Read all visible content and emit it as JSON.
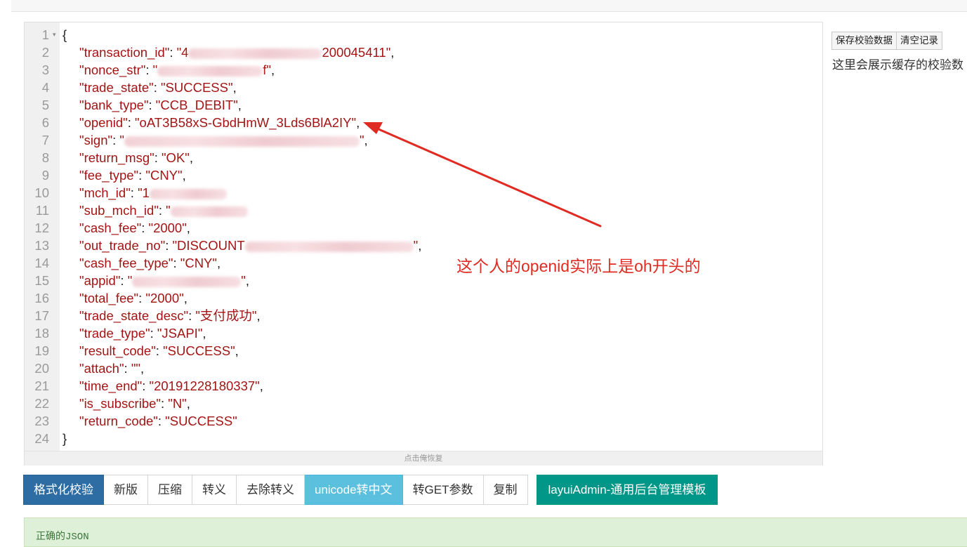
{
  "editor": {
    "lines": [
      {
        "n": "1",
        "fold": "▾",
        "parts": [
          {
            "t": "punc",
            "v": "{"
          }
        ]
      },
      {
        "n": "2",
        "parts": [
          {
            "t": "key",
            "v": "\"transaction_id\""
          },
          {
            "t": "punc",
            "v": ": "
          },
          {
            "t": "str",
            "v": "\"4"
          },
          {
            "t": "blur",
            "w": 190
          },
          {
            "t": "str",
            "v": "200045411\""
          },
          {
            "t": "punc",
            "v": ","
          }
        ]
      },
      {
        "n": "3",
        "parts": [
          {
            "t": "key",
            "v": "\"nonce_str\""
          },
          {
            "t": "punc",
            "v": ": "
          },
          {
            "t": "str",
            "v": "\""
          },
          {
            "t": "blur",
            "w": 150
          },
          {
            "t": "str",
            "v": "f\""
          },
          {
            "t": "punc",
            "v": ","
          }
        ]
      },
      {
        "n": "4",
        "parts": [
          {
            "t": "key",
            "v": "\"trade_state\""
          },
          {
            "t": "punc",
            "v": ": "
          },
          {
            "t": "str",
            "v": "\"SUCCESS\""
          },
          {
            "t": "punc",
            "v": ","
          }
        ]
      },
      {
        "n": "5",
        "parts": [
          {
            "t": "key",
            "v": "\"bank_type\""
          },
          {
            "t": "punc",
            "v": ": "
          },
          {
            "t": "str",
            "v": "\"CCB_DEBIT\""
          },
          {
            "t": "punc",
            "v": ","
          }
        ]
      },
      {
        "n": "6",
        "parts": [
          {
            "t": "key",
            "v": "\"openid\""
          },
          {
            "t": "punc",
            "v": ": "
          },
          {
            "t": "str",
            "v": "\"oAT3B58xS-GbdHmW_3Lds6BlA2IY\""
          },
          {
            "t": "punc",
            "v": ","
          }
        ]
      },
      {
        "n": "7",
        "parts": [
          {
            "t": "key",
            "v": "\"sign\""
          },
          {
            "t": "punc",
            "v": ": "
          },
          {
            "t": "str",
            "v": "\""
          },
          {
            "t": "blur",
            "w": 335
          },
          {
            "t": "str",
            "v": "\""
          },
          {
            "t": "punc",
            "v": ","
          }
        ]
      },
      {
        "n": "8",
        "parts": [
          {
            "t": "key",
            "v": "\"return_msg\""
          },
          {
            "t": "punc",
            "v": ": "
          },
          {
            "t": "str",
            "v": "\"OK\""
          },
          {
            "t": "punc",
            "v": ","
          }
        ]
      },
      {
        "n": "9",
        "parts": [
          {
            "t": "key",
            "v": "\"fee_type\""
          },
          {
            "t": "punc",
            "v": ": "
          },
          {
            "t": "str",
            "v": "\"CNY\""
          },
          {
            "t": "punc",
            "v": ","
          }
        ]
      },
      {
        "n": "10",
        "parts": [
          {
            "t": "key",
            "v": "\"mch_id\""
          },
          {
            "t": "punc",
            "v": ": "
          },
          {
            "t": "str",
            "v": "\"1"
          },
          {
            "t": "blur",
            "w": 110
          }
        ]
      },
      {
        "n": "11",
        "parts": [
          {
            "t": "key",
            "v": "\"sub_mch_id\""
          },
          {
            "t": "punc",
            "v": ": "
          },
          {
            "t": "str",
            "v": "\""
          },
          {
            "t": "blur",
            "w": 110
          }
        ]
      },
      {
        "n": "12",
        "parts": [
          {
            "t": "key",
            "v": "\"cash_fee\""
          },
          {
            "t": "punc",
            "v": ": "
          },
          {
            "t": "str",
            "v": "\"2000\""
          },
          {
            "t": "punc",
            "v": ","
          }
        ]
      },
      {
        "n": "13",
        "parts": [
          {
            "t": "key",
            "v": "\"out_trade_no\""
          },
          {
            "t": "punc",
            "v": ": "
          },
          {
            "t": "str",
            "v": "\"DISCOUNT"
          },
          {
            "t": "blur",
            "w": 240
          },
          {
            "t": "str",
            "v": "\""
          },
          {
            "t": "punc",
            "v": ","
          }
        ]
      },
      {
        "n": "14",
        "parts": [
          {
            "t": "key",
            "v": "\"cash_fee_type\""
          },
          {
            "t": "punc",
            "v": ": "
          },
          {
            "t": "str",
            "v": "\"CNY\""
          },
          {
            "t": "punc",
            "v": ","
          }
        ]
      },
      {
        "n": "15",
        "parts": [
          {
            "t": "key",
            "v": "\"appid\""
          },
          {
            "t": "punc",
            "v": ": "
          },
          {
            "t": "str",
            "v": "\""
          },
          {
            "t": "blur",
            "w": 155
          },
          {
            "t": "str",
            "v": "\""
          },
          {
            "t": "punc",
            "v": ","
          }
        ]
      },
      {
        "n": "16",
        "parts": [
          {
            "t": "key",
            "v": "\"total_fee\""
          },
          {
            "t": "punc",
            "v": ": "
          },
          {
            "t": "str",
            "v": "\"2000\""
          },
          {
            "t": "punc",
            "v": ","
          }
        ]
      },
      {
        "n": "17",
        "parts": [
          {
            "t": "key",
            "v": "\"trade_state_desc\""
          },
          {
            "t": "punc",
            "v": ": "
          },
          {
            "t": "str",
            "v": "\"支付成功\""
          },
          {
            "t": "punc",
            "v": ","
          }
        ]
      },
      {
        "n": "18",
        "parts": [
          {
            "t": "key",
            "v": "\"trade_type\""
          },
          {
            "t": "punc",
            "v": ": "
          },
          {
            "t": "str",
            "v": "\"JSAPI\""
          },
          {
            "t": "punc",
            "v": ","
          }
        ]
      },
      {
        "n": "19",
        "parts": [
          {
            "t": "key",
            "v": "\"result_code\""
          },
          {
            "t": "punc",
            "v": ": "
          },
          {
            "t": "str",
            "v": "\"SUCCESS\""
          },
          {
            "t": "punc",
            "v": ","
          }
        ]
      },
      {
        "n": "20",
        "parts": [
          {
            "t": "key",
            "v": "\"attach\""
          },
          {
            "t": "punc",
            "v": ": "
          },
          {
            "t": "str",
            "v": "\"\""
          },
          {
            "t": "punc",
            "v": ","
          }
        ]
      },
      {
        "n": "21",
        "parts": [
          {
            "t": "key",
            "v": "\"time_end\""
          },
          {
            "t": "punc",
            "v": ": "
          },
          {
            "t": "str",
            "v": "\"20191228180337\""
          },
          {
            "t": "punc",
            "v": ","
          }
        ]
      },
      {
        "n": "22",
        "parts": [
          {
            "t": "key",
            "v": "\"is_subscribe\""
          },
          {
            "t": "punc",
            "v": ": "
          },
          {
            "t": "str",
            "v": "\"N\""
          },
          {
            "t": "punc",
            "v": ","
          }
        ]
      },
      {
        "n": "23",
        "parts": [
          {
            "t": "key",
            "v": "\"return_code\""
          },
          {
            "t": "punc",
            "v": ": "
          },
          {
            "t": "str",
            "v": "\"SUCCESS\""
          }
        ]
      },
      {
        "n": "24",
        "parts": [
          {
            "t": "punc",
            "v": "}"
          }
        ]
      }
    ],
    "restore_label": "点击俺恢复"
  },
  "sidebar": {
    "save_button": "保存校验数据",
    "clear_button": "清空记录",
    "cache_text": "这里会展示缓存的校验数"
  },
  "toolbar": {
    "buttons": [
      {
        "label": "格式化校验",
        "style": "first"
      },
      {
        "label": "新版",
        "style": ""
      },
      {
        "label": "压缩",
        "style": ""
      },
      {
        "label": "转义",
        "style": ""
      },
      {
        "label": "去除转义",
        "style": ""
      },
      {
        "label": "unicode转中文",
        "style": "info"
      },
      {
        "label": "转GET参数",
        "style": ""
      },
      {
        "label": "复制",
        "style": ""
      }
    ],
    "promo": "layuiAdmin-通用后台管理模板"
  },
  "status": {
    "message": "正确的JSON"
  },
  "annotation": {
    "text": "这个人的openid实际上是oh开头的",
    "color": "#e02b22"
  }
}
